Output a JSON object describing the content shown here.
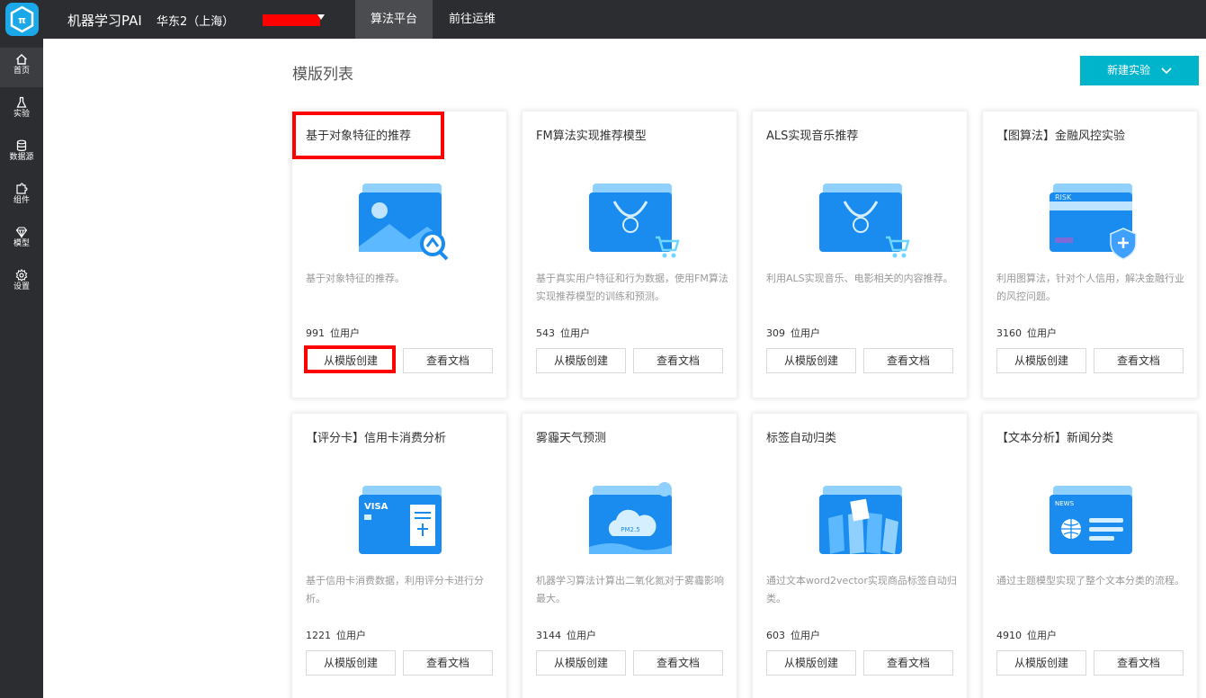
{
  "topbar": {
    "app_title": "机器学习PAI",
    "region": "华东2（上海）",
    "tabs": [
      {
        "label": "算法平台",
        "active": true
      },
      {
        "label": "前往运维",
        "active": false
      }
    ]
  },
  "sidebar": {
    "items": [
      {
        "label": "首页",
        "icon": "home-icon",
        "active": true
      },
      {
        "label": "实验",
        "icon": "flask-icon"
      },
      {
        "label": "数据源",
        "icon": "database-icon"
      },
      {
        "label": "组件",
        "icon": "puzzle-icon"
      },
      {
        "label": "模型",
        "icon": "diamond-icon"
      },
      {
        "label": "设置",
        "icon": "gear-icon"
      }
    ]
  },
  "main": {
    "title": "模版列表",
    "new_button": "新建实验",
    "create_label": "从模版创建",
    "docs_label": "查看文档",
    "cards": [
      {
        "title": "基于对象特征的推荐",
        "desc": "基于对象特征的推荐。",
        "count": "991",
        "unit": "位用户",
        "illus": "image-search"
      },
      {
        "title": "FM算法实现推荐模型",
        "desc": "基于真实用户特征和行为数据，使用FM算法实现推荐模型的训练和预测。",
        "count": "543",
        "unit": "位用户",
        "illus": "shopping-bag"
      },
      {
        "title": "ALS实现音乐推荐",
        "desc": "利用ALS实现音乐、电影相关的内容推荐。",
        "count": "309",
        "unit": "位用户",
        "illus": "shopping-bag"
      },
      {
        "title": "【图算法】金融风控实验",
        "desc": "利用图算法，针对个人信用，解决金融行业的风控问题。",
        "count": "3160",
        "unit": "位用户",
        "illus": "risk-card"
      },
      {
        "title": "【评分卡】信用卡消费分析",
        "desc": "基于信用卡消费数据，利用评分卡进行分析。",
        "count": "1221",
        "unit": "位用户",
        "illus": "visa-card"
      },
      {
        "title": "雾霾天气预测",
        "desc": "机器学习算法计算出二氧化氮对于雾霾影响最大。",
        "count": "3144",
        "unit": "位用户",
        "illus": "pm25-cloud"
      },
      {
        "title": "标签自动归类",
        "desc": "通过文本word2vector实现商品标签自动归类。",
        "count": "603",
        "unit": "位用户",
        "illus": "tags"
      },
      {
        "title": "【文本分析】新闻分类",
        "desc": "通过主题模型实现了整个文本分类的流程。",
        "count": "4910",
        "unit": "位用户",
        "illus": "news"
      }
    ]
  },
  "colors": {
    "topbar_bg": "#2b2d30",
    "accent": "#00b4cc",
    "highlight": "#ff0000",
    "illus_blue": "#1a8cf0"
  }
}
